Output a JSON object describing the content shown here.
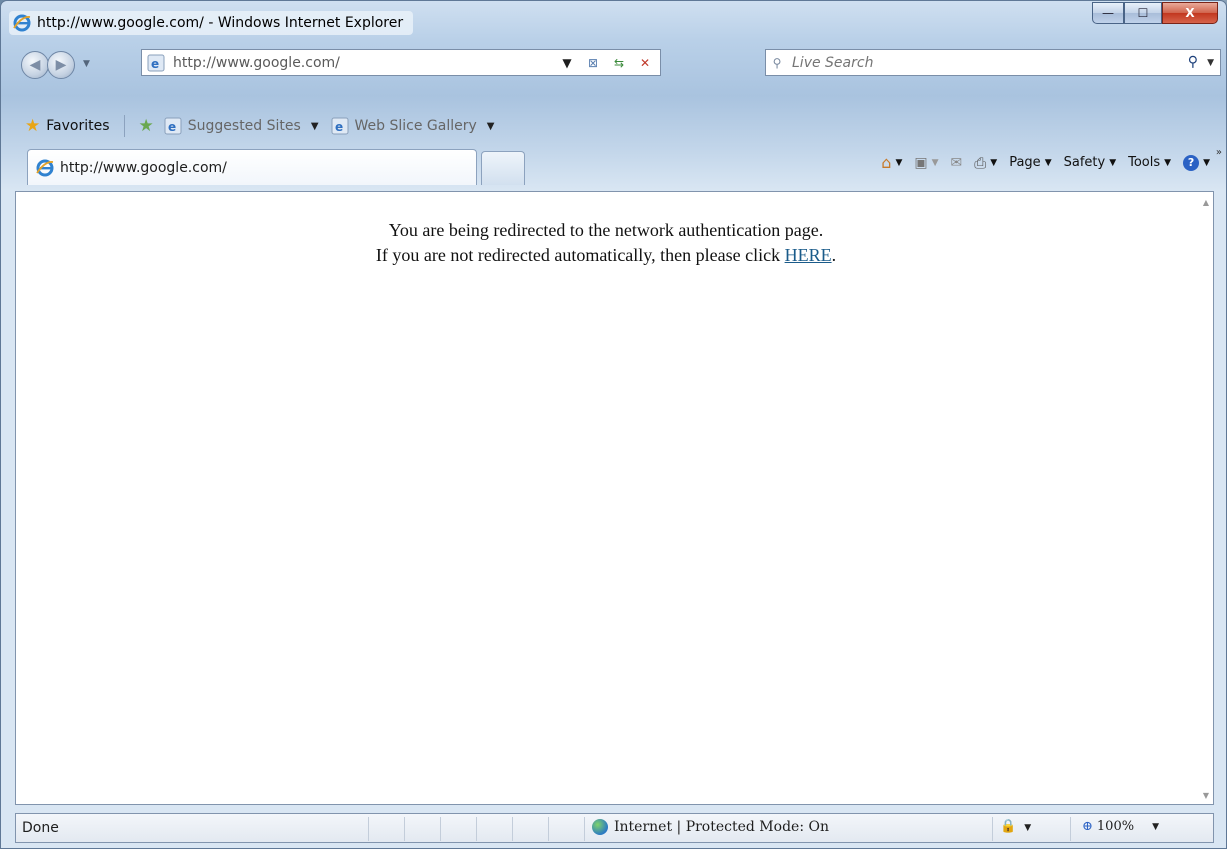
{
  "window": {
    "title": "http://www.google.com/ - Windows Internet Explorer",
    "controls": {
      "minimize": "—",
      "maximize": "☐",
      "close": "X"
    }
  },
  "navigation": {
    "address": "http://www.google.com/",
    "search_placeholder": "Live Search",
    "icons": [
      "back-icon",
      "forward-icon",
      "compatibility-icon",
      "refresh-icon",
      "stop-icon",
      "search-icon"
    ]
  },
  "favorites_bar": {
    "favorites_label": "Favorites",
    "items": [
      "Suggested Sites",
      "Web Slice Gallery"
    ]
  },
  "tabs": {
    "active_tab_title": "http://www.google.com/"
  },
  "command_bar": {
    "page": "Page",
    "safety": "Safety",
    "tools": "Tools",
    "icons": [
      "home-icon",
      "feeds-icon",
      "mail-icon",
      "print-icon",
      "help-icon"
    ]
  },
  "content": {
    "line1": "You are being redirected to the network authentication page.",
    "line2_prefix": "If you are not redirected automatically, then please click ",
    "link_text": "HERE",
    "line2_suffix": "."
  },
  "status_bar": {
    "status": "Done",
    "zone": "Internet | Protected Mode: On",
    "zoom": "100%"
  },
  "colors": {
    "link": "#1a5b8a",
    "close_button": "#c2371f",
    "frame": "#b9d0e8"
  }
}
